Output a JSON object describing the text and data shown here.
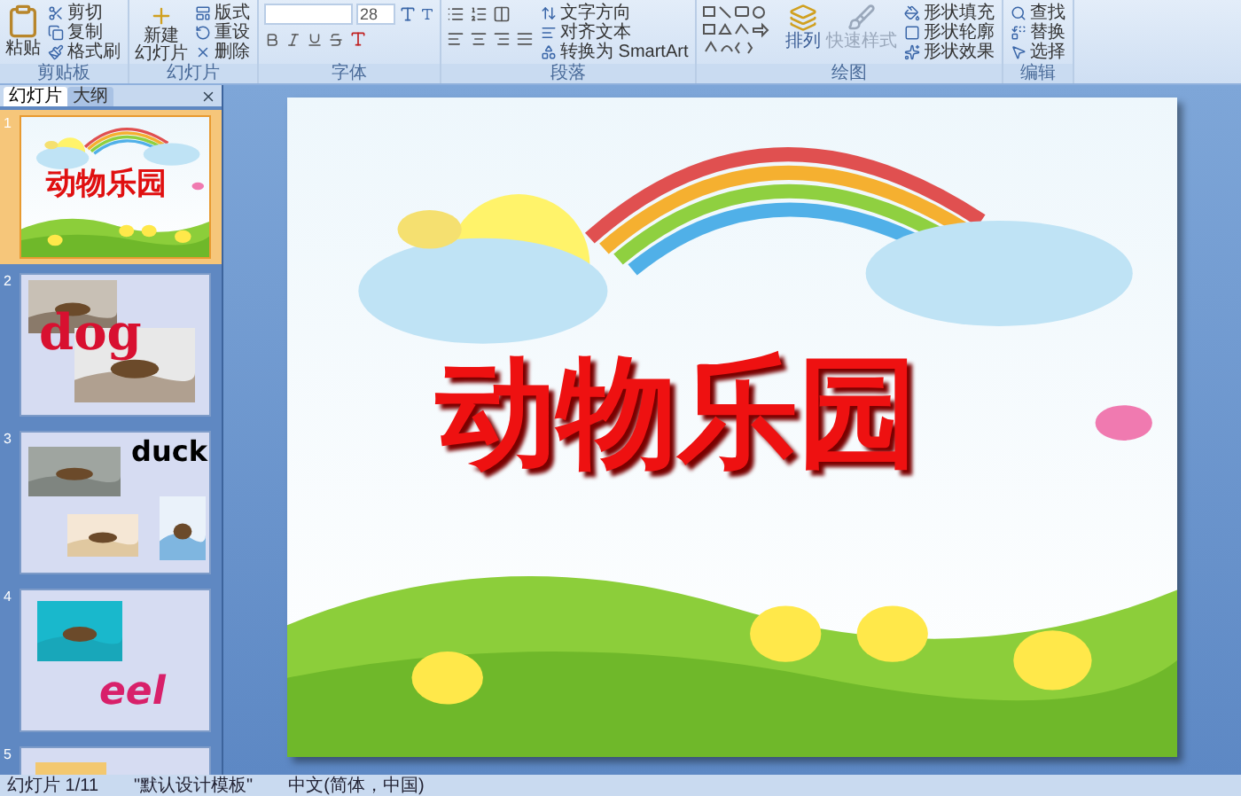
{
  "ribbon": {
    "groups": [
      {
        "label": "剪贴板",
        "large": [
          "粘贴"
        ],
        "small": [
          "剪切",
          "复制",
          "格式刷"
        ]
      },
      {
        "label": "幻灯片",
        "large": [
          "新建",
          "幻灯片"
        ],
        "small": [
          "版式",
          "重设",
          "删除"
        ]
      },
      {
        "label": "字体",
        "font_size": "28"
      },
      {
        "label": "段落",
        "small": [
          "文字方向",
          "对齐文本",
          "转换为 SmartArt"
        ]
      },
      {
        "label": "绘图",
        "buttons": [
          "排列",
          "快速样式"
        ],
        "small": [
          "形状填充",
          "形状轮廓",
          "形状效果"
        ]
      },
      {
        "label": "编辑",
        "small": [
          "查找",
          "替换",
          "选择"
        ]
      }
    ]
  },
  "pane": {
    "tabs": [
      {
        "label": "幻灯片",
        "selected": true
      },
      {
        "label": "大纲",
        "selected": false
      }
    ],
    "slides": [
      {
        "number": "1",
        "kind": "title",
        "text": "动物乐园",
        "selected": true
      },
      {
        "number": "2",
        "text": "dog",
        "selected": false
      },
      {
        "number": "3",
        "text": "duck",
        "selected": false
      },
      {
        "number": "4",
        "text": "eel",
        "selected": false
      },
      {
        "number": "5",
        "selected": false
      }
    ]
  },
  "slide": {
    "title": "动物乐园"
  },
  "status_bar": [
    "幻灯片 1/11",
    "\"默认设计模板\"",
    "中文(简体，中国)"
  ]
}
